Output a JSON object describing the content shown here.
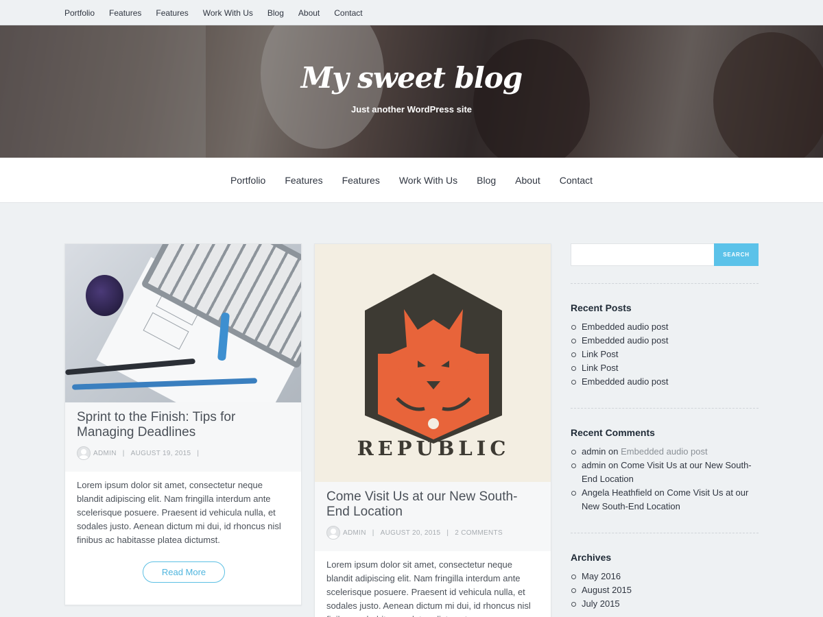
{
  "topnav": [
    "Portfolio",
    "Features",
    "Features",
    "Work With Us",
    "Blog",
    "About",
    "Contact"
  ],
  "header": {
    "site_title": "My sweet blog",
    "tagline": "Just another WordPress site"
  },
  "mainnav": [
    "Portfolio",
    "Features",
    "Features",
    "Work With Us",
    "Blog",
    "About",
    "Contact"
  ],
  "posts": [
    {
      "title": "Sprint to the Finish: Tips for Managing Deadlines",
      "author": "ADMIN",
      "date": "AUGUST 19, 2015",
      "excerpt": "Lorem ipsum dolor sit amet, consectetur neque blandit adipiscing elit. Nam fringilla interdum ante scelerisque posuere. Praesent id vehicula nulla, et sodales justo. Aenean dictum mi dui, id rhoncus nisl finibus ac habitasse platea dictumst.",
      "read_more": "Read More"
    },
    {
      "title": "Come Visit Us at our New South-End Location",
      "author": "ADMIN",
      "date": "AUGUST 20, 2015",
      "comments": "2 COMMENTS",
      "image_text": "REPUBLIC",
      "excerpt": "Lorem ipsum dolor sit amet, consectetur neque blandit adipiscing elit. Nam fringilla interdum ante scelerisque posuere. Praesent id vehicula nulla, et sodales justo. Aenean dictum mi dui, id rhoncus nisl finibus ac habitasse platea dictumst."
    }
  ],
  "sidebar": {
    "search_button": "SEARCH",
    "recent_posts": {
      "title": "Recent Posts",
      "items": [
        "Embedded audio post",
        "Embedded audio post",
        "Link Post",
        "Link Post",
        "Embedded audio post"
      ]
    },
    "recent_comments": {
      "title": "Recent Comments",
      "items": [
        {
          "author": "admin",
          "on": "on",
          "post": "Embedded audio post"
        },
        {
          "author": "admin",
          "on": "on",
          "post": "Come Visit Us at our New South-End Location"
        },
        {
          "author": "Angela Heathfield",
          "on": "on",
          "post": "Come Visit Us at our New South-End Location"
        }
      ]
    },
    "archives": {
      "title": "Archives",
      "items": [
        "May 2016",
        "August 2015",
        "July 2015"
      ]
    }
  },
  "colors": {
    "accent": "#5bc2e9",
    "fox_orange": "#e8643a",
    "shield_dark": "#3d3a33",
    "poster_bg": "#f3eee2"
  }
}
